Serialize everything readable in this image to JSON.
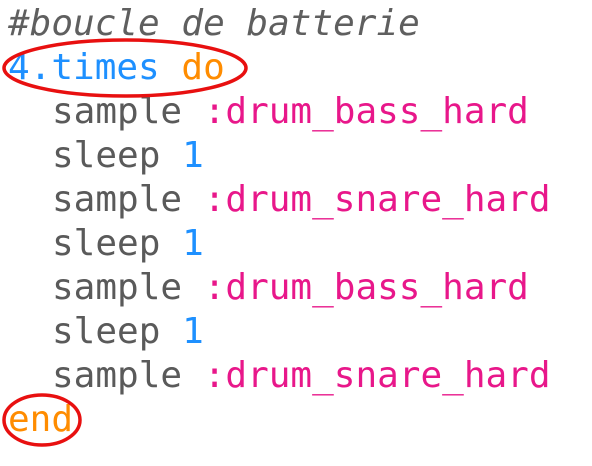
{
  "editor": {
    "lines": [
      {
        "comment": "#boucle de batterie"
      },
      {
        "number": "4",
        "method": ".times",
        "space": " ",
        "keyword": "do"
      },
      {
        "fn": "sample",
        "space": " ",
        "symbol": ":drum_bass_hard"
      },
      {
        "fn": "sleep",
        "space": " ",
        "number": "1"
      },
      {
        "fn": "sample",
        "space": " ",
        "symbol": ":drum_snare_hard"
      },
      {
        "fn": "sleep",
        "space": " ",
        "number": "1"
      },
      {
        "fn": "sample",
        "space": " ",
        "symbol": ":drum_bass_hard"
      },
      {
        "fn": "sleep",
        "space": " ",
        "number": "1"
      },
      {
        "fn": "sample",
        "space": " ",
        "symbol": ":drum_snare_hard"
      },
      {
        "keyword": "end"
      }
    ]
  },
  "colors": {
    "comment": "#5f5f5f",
    "number": "#1e90ff",
    "method": "#1e90ff",
    "keyword": "#ff8c00",
    "function": "#5a5a5a",
    "symbol": "#e8178a",
    "annotation": "#e81010"
  }
}
